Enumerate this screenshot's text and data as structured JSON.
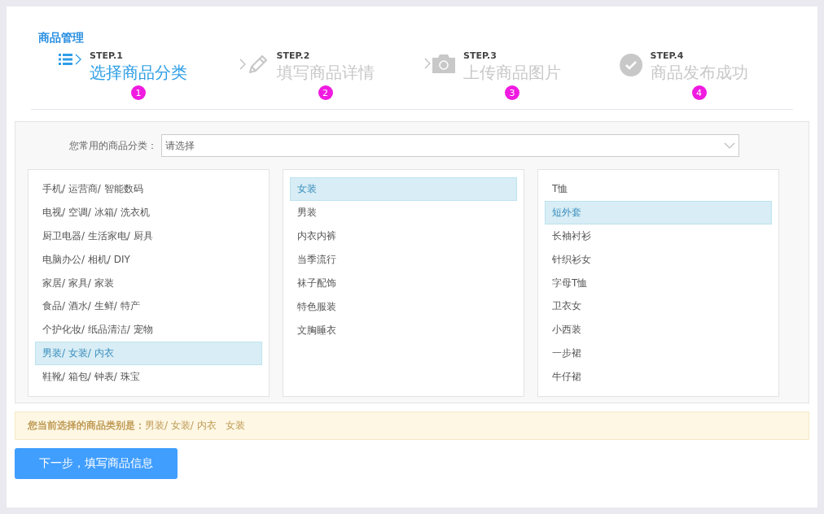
{
  "page_title": "商品管理",
  "steps": [
    {
      "kind": "list",
      "step": "STEP.1",
      "title": "选择商品分类",
      "badge": "1",
      "selected": true,
      "chevron": false
    },
    {
      "kind": "pencil",
      "step": "STEP.2",
      "title": "填写商品详情",
      "badge": "2",
      "selected": false,
      "chevron": true
    },
    {
      "kind": "camera",
      "step": "STEP.3",
      "title": "上传商品图片",
      "badge": "3",
      "selected": false,
      "chevron": true
    },
    {
      "kind": "check",
      "step": "STEP.4",
      "title": "商品发布成功",
      "badge": "4",
      "selected": false,
      "chevron": false
    }
  ],
  "common_category": {
    "label": "您常用的商品分类：",
    "placeholder": "请选择"
  },
  "columns": [
    {
      "items": [
        {
          "label": "手机/ 运营商/ 智能数码",
          "selected": false
        },
        {
          "label": "电视/ 空调/ 冰箱/ 洗衣机",
          "selected": false
        },
        {
          "label": "厨卫电器/ 生活家电/ 厨具",
          "selected": false
        },
        {
          "label": "电脑办公/ 相机/ DIY",
          "selected": false
        },
        {
          "label": "家居/ 家具/ 家装",
          "selected": false
        },
        {
          "label": "食品/ 酒水/ 生鲜/ 特产",
          "selected": false
        },
        {
          "label": "个护化妆/ 纸品清洁/ 宠物",
          "selected": false
        },
        {
          "label": "男装/ 女装/ 内衣",
          "selected": true
        },
        {
          "label": "鞋靴/ 箱包/ 钟表/ 珠宝",
          "selected": false
        }
      ]
    },
    {
      "items": [
        {
          "label": "女装",
          "selected": true
        },
        {
          "label": "男装",
          "selected": false
        },
        {
          "label": "内衣内裤",
          "selected": false
        },
        {
          "label": "当季流行",
          "selected": false
        },
        {
          "label": "袜子配饰",
          "selected": false
        },
        {
          "label": "特色服装",
          "selected": false
        },
        {
          "label": "文胸睡衣",
          "selected": false
        }
      ]
    },
    {
      "items": [
        {
          "label": "T恤",
          "selected": false
        },
        {
          "label": "短外套",
          "selected": true
        },
        {
          "label": "长袖衬衫",
          "selected": false
        },
        {
          "label": "针织衫女",
          "selected": false
        },
        {
          "label": "字母T恤",
          "selected": false
        },
        {
          "label": "卫衣女",
          "selected": false
        },
        {
          "label": "小西装",
          "selected": false
        },
        {
          "label": "一步裙",
          "selected": false
        },
        {
          "label": "牛仔裙",
          "selected": false
        }
      ]
    }
  ],
  "notice": "**您当前选择的商品类别是：**男装/ 女装/ 内衣   女装",
  "next_button": "下一步，填写商品信息"
}
